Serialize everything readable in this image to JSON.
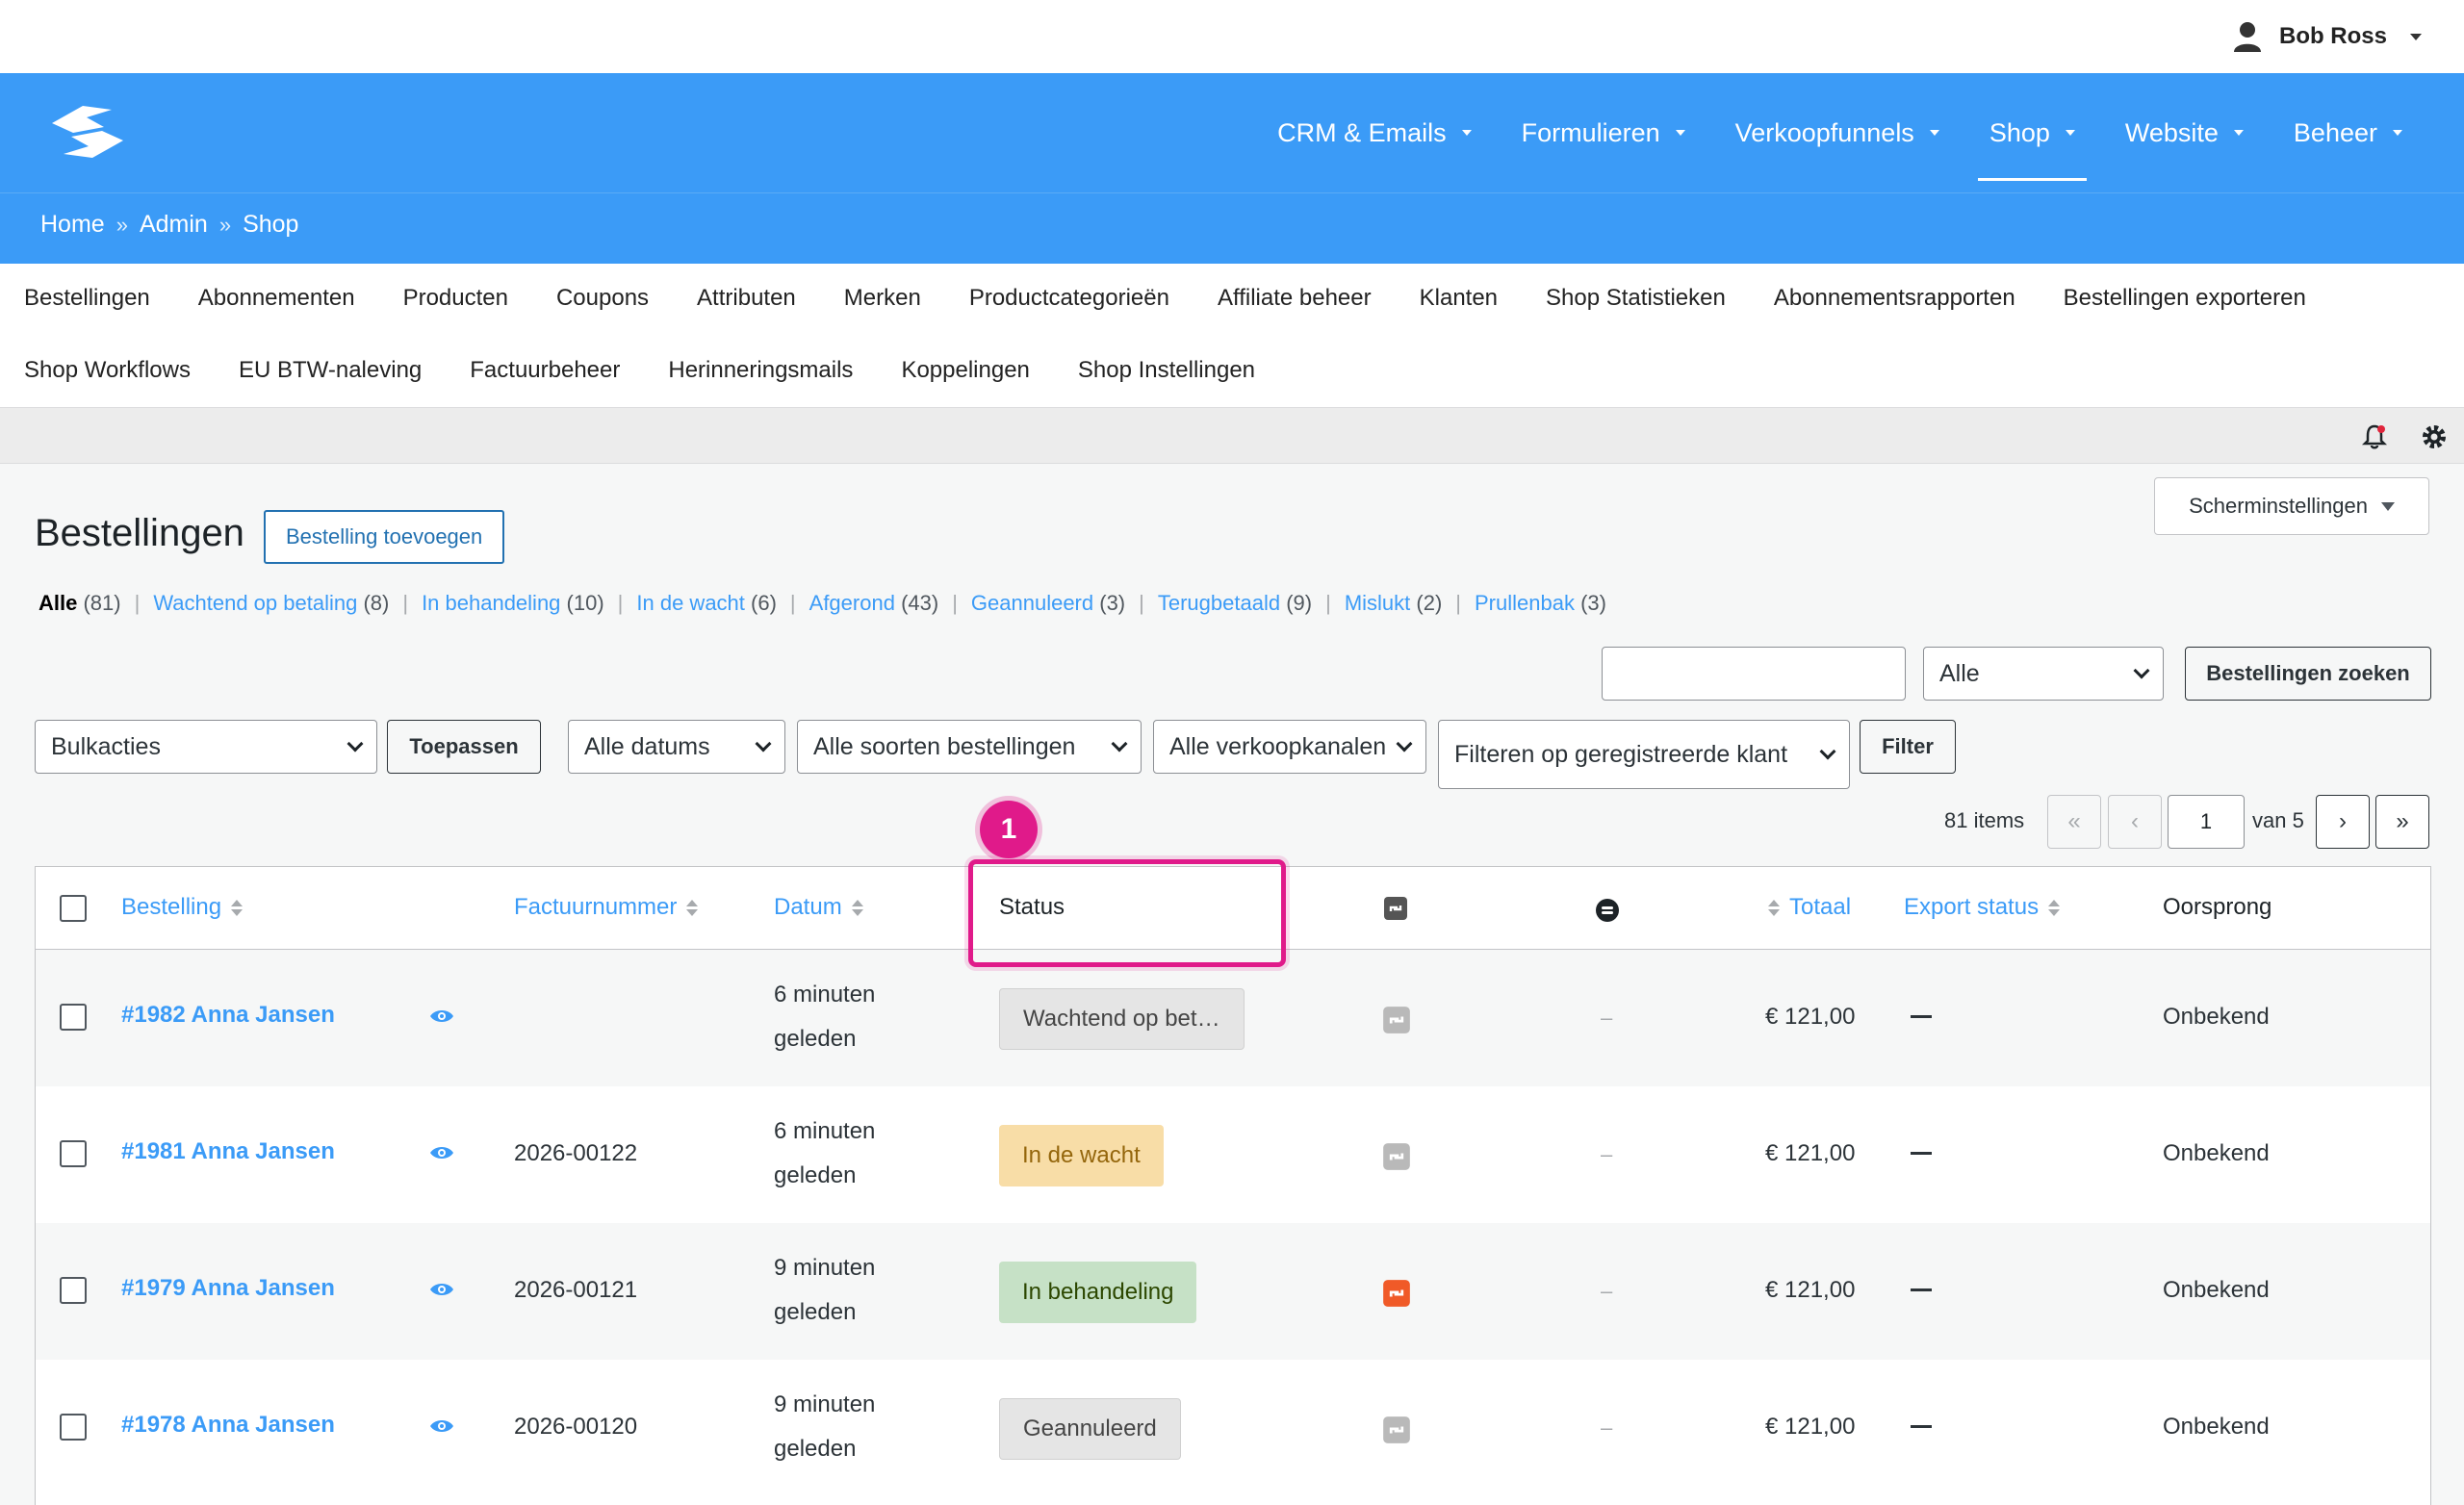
{
  "user": {
    "name": "Bob Ross"
  },
  "main_nav": [
    {
      "label": "CRM & Emails"
    },
    {
      "label": "Formulieren"
    },
    {
      "label": "Verkoopfunnels"
    },
    {
      "label": "Shop"
    },
    {
      "label": "Website"
    },
    {
      "label": "Beheer"
    }
  ],
  "active_nav": "Shop",
  "breadcrumb": {
    "home": "Home",
    "admin": "Admin",
    "shop": "Shop",
    "sep": "»"
  },
  "submenu_row1": [
    "Bestellingen",
    "Abonnementen",
    "Producten",
    "Coupons",
    "Attributen",
    "Merken",
    "Productcategorieën",
    "Affiliate beheer",
    "Klanten",
    "Shop Statistieken",
    "Abonnementsrapporten",
    "Bestellingen exporteren"
  ],
  "submenu_row2": [
    "Shop Workflows",
    "EU BTW-naleving",
    "Factuurbeheer",
    "Herinneringsmails",
    "Koppelingen",
    "Shop Instellingen"
  ],
  "screen_options": "Scherminstellingen",
  "page": {
    "title": "Bestellingen",
    "add_button": "Bestelling toevoegen"
  },
  "status_filters": [
    {
      "label": "Alle",
      "count": "(81)"
    },
    {
      "label": "Wachtend op betaling",
      "count": "(8)"
    },
    {
      "label": "In behandeling",
      "count": "(10)"
    },
    {
      "label": "In de wacht",
      "count": "(6)"
    },
    {
      "label": "Afgerond",
      "count": "(43)"
    },
    {
      "label": "Geannuleerd",
      "count": "(3)"
    },
    {
      "label": "Terugbetaald",
      "count": "(9)"
    },
    {
      "label": "Mislukt",
      "count": "(2)"
    },
    {
      "label": "Prullenbak",
      "count": "(3)"
    }
  ],
  "search": {
    "value": "",
    "scope": "Alle",
    "button": "Bestellingen zoeken"
  },
  "filters": {
    "bulk": "Bulkacties",
    "apply": "Toepassen",
    "dates": "Alle datums",
    "types": "Alle soorten bestellingen",
    "channels": "Alle verkoopkanalen",
    "customer": "Filteren op geregistreerde klant",
    "filter_button": "Filter"
  },
  "pagination": {
    "items": "81 items",
    "first": "«",
    "prev": "‹",
    "current": "1",
    "of": "van 5",
    "next": "›",
    "last": "»"
  },
  "columns": {
    "order": "Bestelling",
    "invoice": "Factuurnummer",
    "date": "Datum",
    "status": "Status",
    "total": "Totaal",
    "export": "Export status",
    "origin": "Oorsprong"
  },
  "rows": [
    {
      "order": "#1982 Anna Jansen",
      "invoice": "",
      "date1": "6 minuten",
      "date2": "geleden",
      "status": "Wachtend op bet…",
      "dash": "–",
      "total": "€ 121,00",
      "origin": "Onbekend"
    },
    {
      "order": "#1981 Anna Jansen",
      "invoice": "2026-00122",
      "date1": "6 minuten",
      "date2": "geleden",
      "status": "In de wacht",
      "dash": "–",
      "total": "€ 121,00",
      "origin": "Onbekend"
    },
    {
      "order": "#1979 Anna Jansen",
      "invoice": "2026-00121",
      "date1": "9 minuten",
      "date2": "geleden",
      "status": "In behandeling",
      "dash": "–",
      "total": "€ 121,00",
      "origin": "Onbekend"
    },
    {
      "order": "#1978 Anna Jansen",
      "invoice": "2026-00120",
      "date1": "9 minuten",
      "date2": "geleden",
      "status": "Geannuleerd",
      "dash": "–",
      "total": "€ 121,00",
      "origin": "Onbekend"
    }
  ],
  "annotation": {
    "number": "1"
  },
  "colors": {
    "brand_blue": "#3b9bf7",
    "highlight_pink": "#e01a8a",
    "accent_orange": "#f05a28"
  },
  "icons": [
    "user-icon",
    "logo-icon",
    "bell-icon",
    "gear-icon",
    "eye-icon",
    "sync-icon",
    "channel-icon"
  ]
}
